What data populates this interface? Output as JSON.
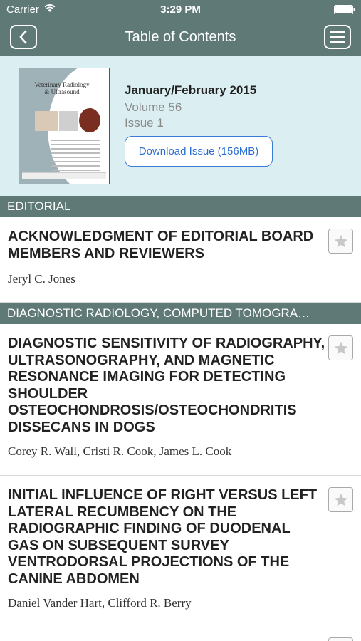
{
  "status_bar": {
    "carrier": "Carrier",
    "time": "3:29 PM"
  },
  "nav": {
    "title": "Table of Contents",
    "back_icon": "chevron-left-icon",
    "menu_icon": "hamburger-menu-icon"
  },
  "issue": {
    "cover_title": "Veterinary Radiology & Ultrasound",
    "date": "January/February 2015",
    "volume": "Volume 56",
    "issue": "Issue 1",
    "download_label": "Download Issue (156MB)"
  },
  "sections": [
    {
      "label": "EDITORIAL"
    },
    {
      "label": "DIAGNOSTIC RADIOLOGY, COMPUTED TOMOGRA…"
    }
  ],
  "articles": [
    {
      "title": "ACKNOWLEDGMENT OF EDITORIAL BOARD MEMBERS AND REVIEWERS",
      "authors": "Jeryl C. Jones"
    },
    {
      "title": "DIAGNOSTIC SENSITIVITY OF RADIOGRAPHY, ULTRASONOGRAPHY, AND MAGNETIC RESONANCE IMAGING FOR DETECTING SHOULDER OSTEOCHONDROSIS/OSTEOCHONDRITIS DISSECANS IN DOGS",
      "authors": "Corey R. Wall, Cristi R. Cook, James L. Cook"
    },
    {
      "title": "INITIAL INFLUENCE OF RIGHT VERSUS LEFT LATERAL RECUMBENCY ON THE RADIOGRAPHIC FINDING OF DUODENAL GAS ON SUBSEQUENT SURVEY VENTRODORSAL PROJECTIONS OF THE CANINE ABDOMEN",
      "authors": "Daniel Vander Hart, Clifford R. Berry"
    }
  ],
  "colors": {
    "header": "#5f7976",
    "panel": "#dbeff2",
    "accent": "#2d6fd1"
  }
}
